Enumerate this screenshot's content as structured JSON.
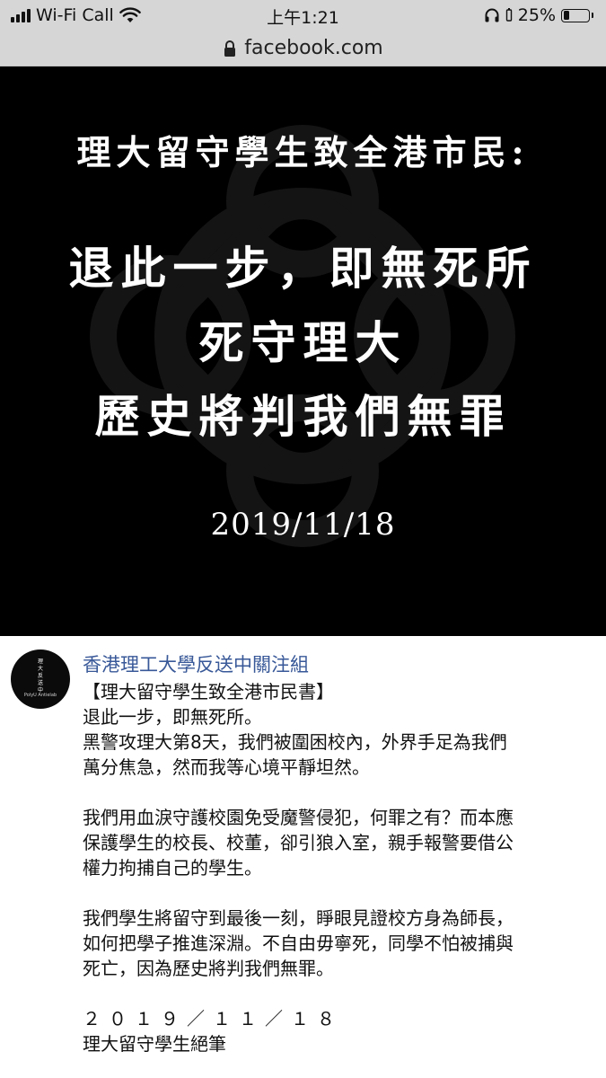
{
  "status_bar": {
    "carrier": "Wi-Fi Call",
    "time": "上午1:21",
    "battery_text": "25%",
    "battery_level": 0.25,
    "icons": [
      "signal-bars-icon",
      "wifi-icon",
      "headphones-icon",
      "battery-icon"
    ]
  },
  "browser": {
    "url": "facebook.com",
    "lock_icon": "lock-icon"
  },
  "hero": {
    "subtitle": "理大留守學生致全港市民:",
    "line1": "退此一步，即無死所",
    "line2": "死守理大",
    "line3": "歷史將判我們無罪",
    "date": "2019/11/18",
    "background_color": "#000000"
  },
  "post": {
    "avatar": {
      "vertical_text": [
        "理",
        "大",
        "反",
        "送",
        "中"
      ],
      "caption": "PolyU Antielab"
    },
    "author": "香港理工大學反送中關注組",
    "author_color": "#385898",
    "paragraphs": [
      [
        "【理大留守學生致全港市民書】",
        "退此一步，即無死所。",
        "黑警攻理大第8天，我們被圍困校內，外界手足為我們",
        "萬分焦急，然而我等心境平靜坦然。"
      ],
      [
        "我們用血淚守護校園免受魔警侵犯，何罪之有？而本應",
        "保護學生的校長、校董，卻引狼入室，親手報警要借公",
        "權力拘捕自己的學生。"
      ],
      [
        "我們學生將留守到最後一刻，睜眼見證校方身為師長，",
        "如何把學子推進深淵。不自由毋寧死，同學不怕被捕與",
        "死亡，因為歷史將判我們無罪。"
      ]
    ],
    "sign_date": "２０１９／１１／１８",
    "signature": "理大留守學生絕筆"
  }
}
